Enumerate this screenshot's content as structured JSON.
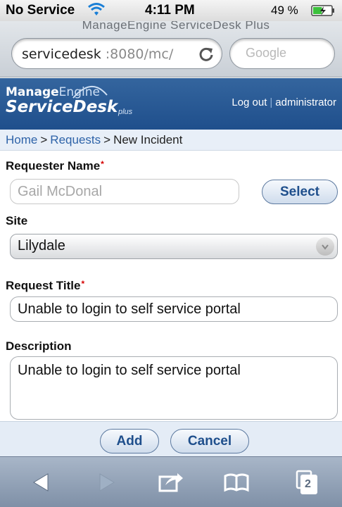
{
  "status_bar": {
    "carrier": "No Service",
    "time": "4:11 PM",
    "battery_percent": "49 %",
    "battery_level": 0.49
  },
  "browser": {
    "faded_title": "ManageEngine ServiceDesk Plus",
    "url_host": "servicedesk",
    "url_path": ":8080/mc/",
    "search_placeholder": "Google"
  },
  "app_header": {
    "brand_top_bold": "Manage",
    "brand_top_light": "Engine",
    "brand_bottom": "ServiceDesk",
    "brand_plus": "plus",
    "logout": "Log out",
    "user": "administrator"
  },
  "breadcrumb": {
    "home": "Home",
    "separator": ">",
    "requests": "Requests",
    "current": "New Incident"
  },
  "form": {
    "requester_label": "Requester Name",
    "requester_value": "Gail McDonal",
    "select_button": "Select",
    "site_label": "Site",
    "site_value": "Lilydale",
    "title_label": "Request Title",
    "title_value": "Unable to login to self service portal",
    "description_label": "Description",
    "description_value": "Unable to login to self service portal",
    "required_marker": "*"
  },
  "actions": {
    "add": "Add",
    "cancel": "Cancel"
  },
  "toolbar": {
    "tabs_count": "2"
  },
  "colors": {
    "header_blue": "#2a5a96",
    "link_blue": "#2e63a8",
    "required_red": "#d40000"
  },
  "icons": [
    "wifi-icon",
    "battery-icon",
    "reload-icon",
    "back-icon",
    "forward-icon",
    "share-icon",
    "bookmarks-icon",
    "tabs-icon"
  ]
}
